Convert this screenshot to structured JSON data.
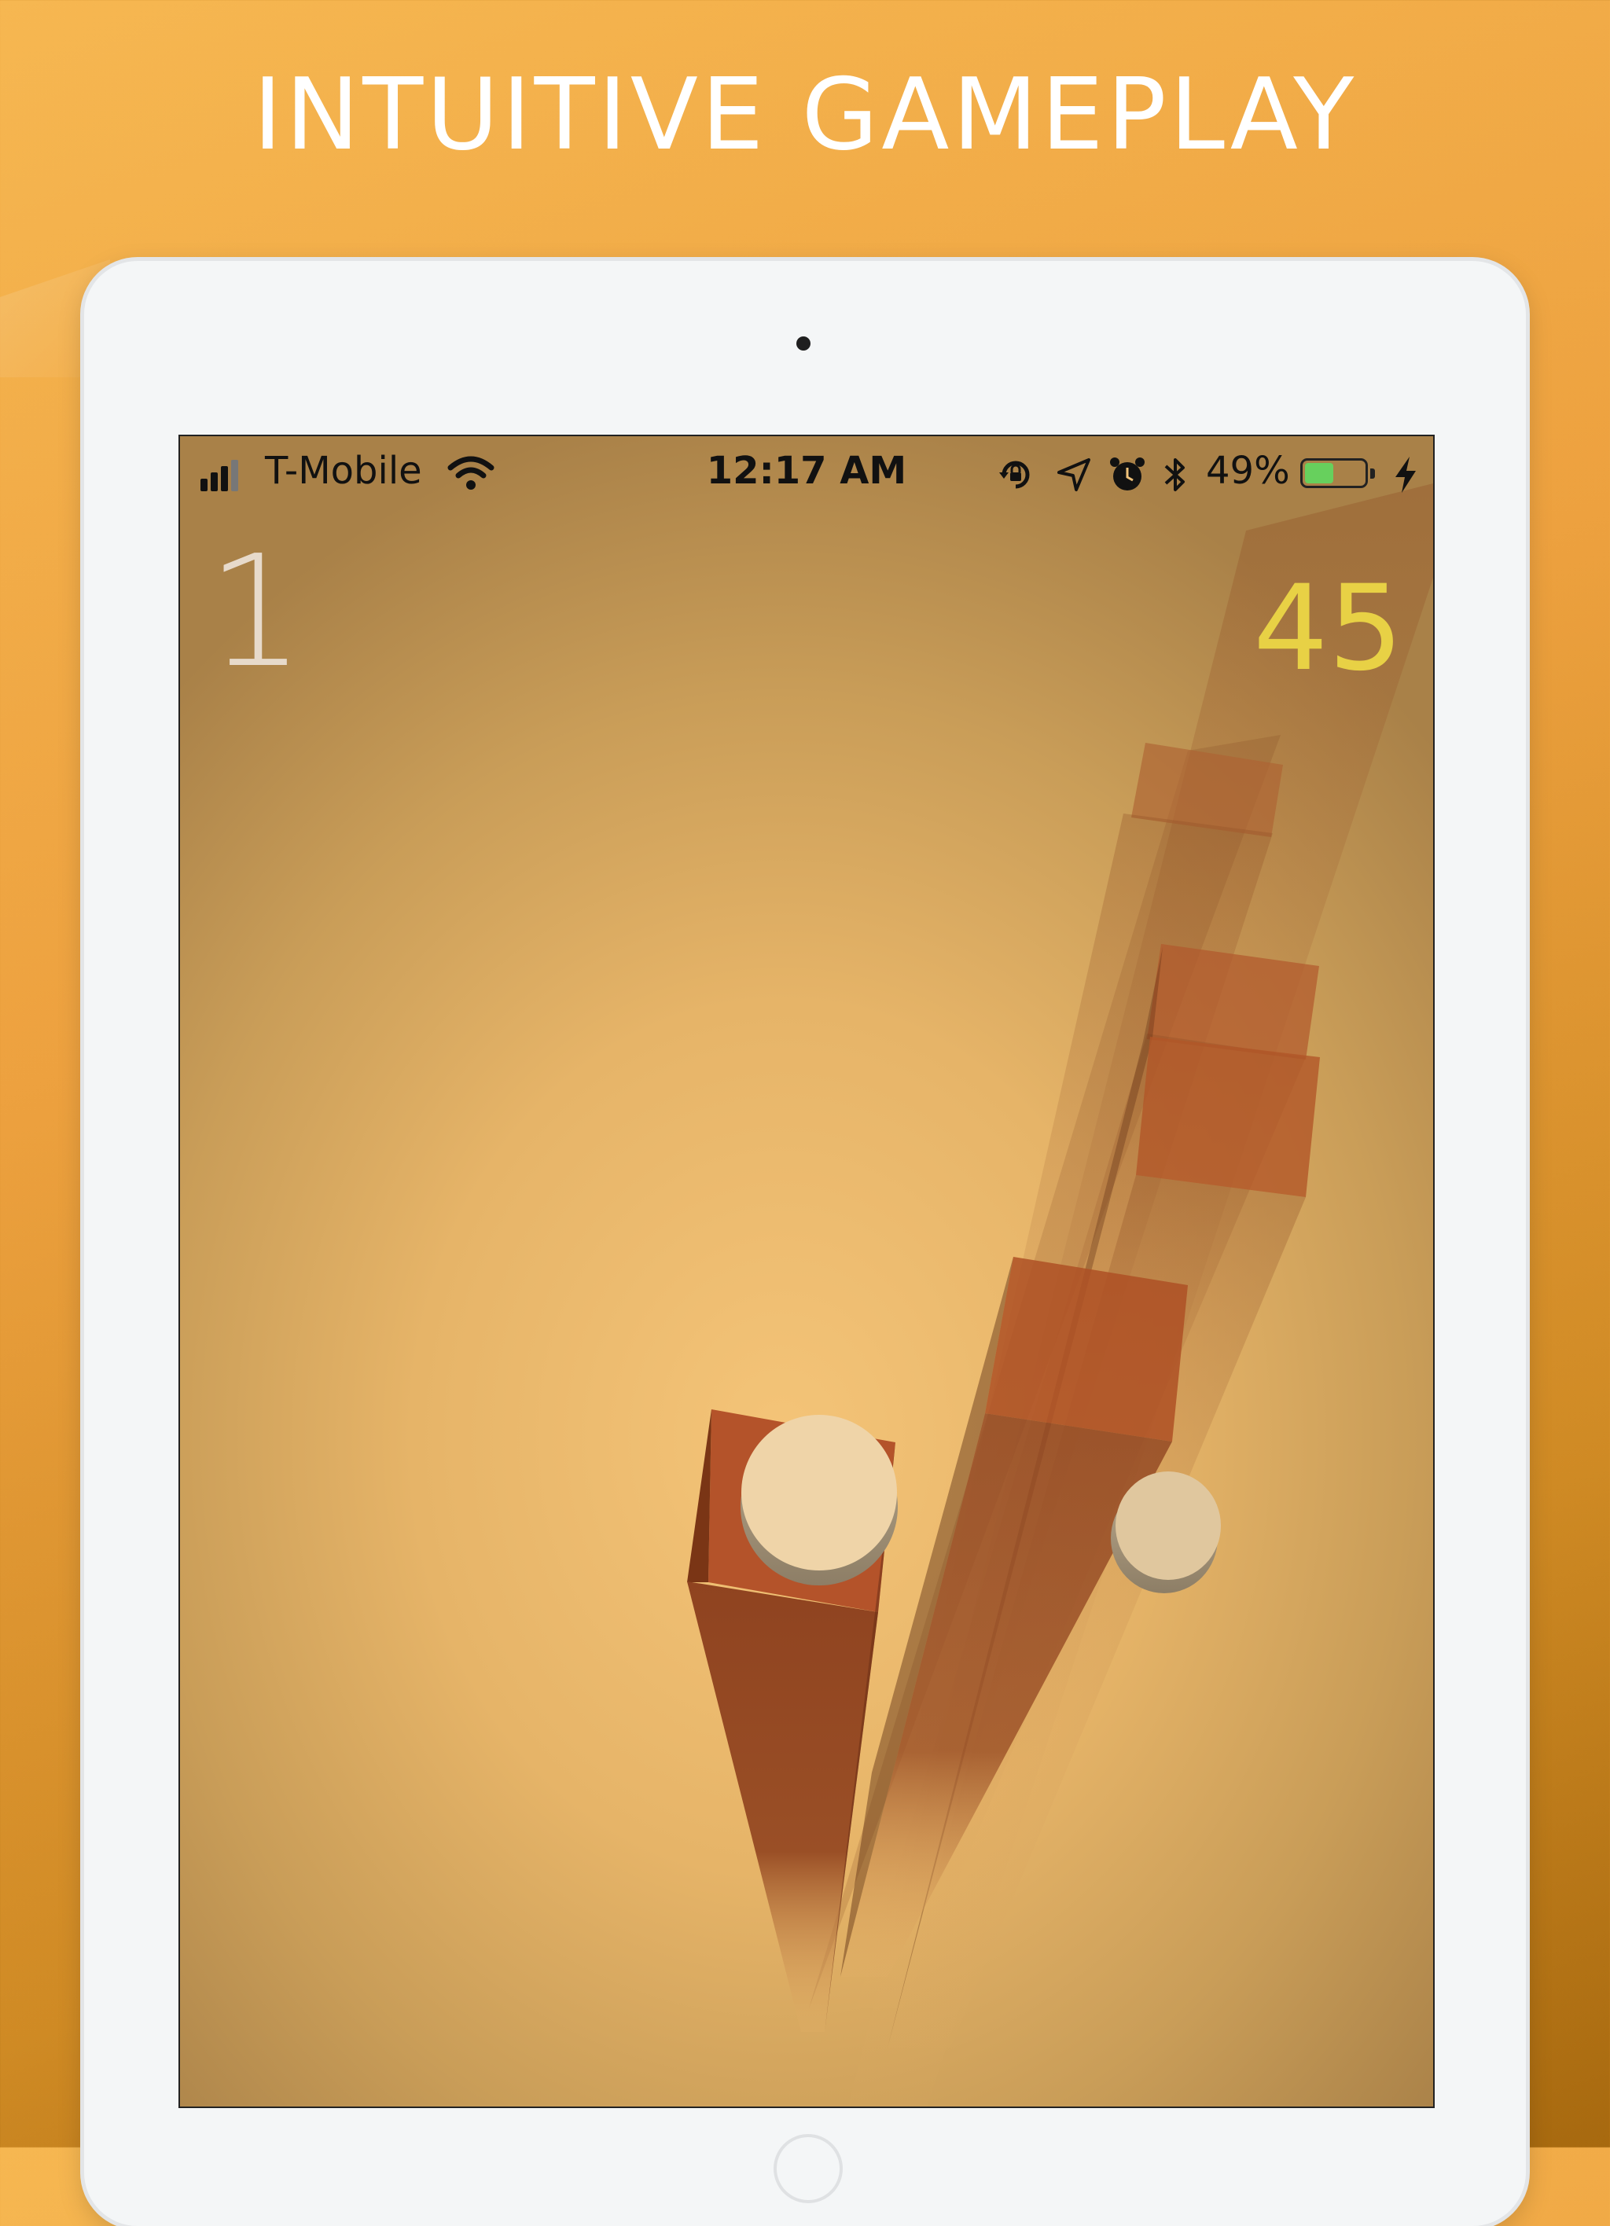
{
  "headline": "INTUITIVE GAMEPLAY",
  "status_bar": {
    "carrier": "T-Mobile",
    "time": "12:17 AM",
    "battery_percent_label": "49%",
    "battery_level": 0.49,
    "signal_bars_active": 3,
    "icons": [
      "signal-icon",
      "wifi-icon",
      "orientation-lock-icon",
      "location-icon",
      "alarm-icon",
      "bluetooth-icon",
      "battery-icon",
      "charging-icon"
    ]
  },
  "game": {
    "score_left": "1",
    "score_right": "45"
  },
  "colors": {
    "background_top": "#f6b751",
    "background_bottom": "#a7690f",
    "score_right": "#e8d145",
    "pillar": "#b0532a",
    "ball": "#efd4a8",
    "battery_fill": "#67d05d"
  }
}
